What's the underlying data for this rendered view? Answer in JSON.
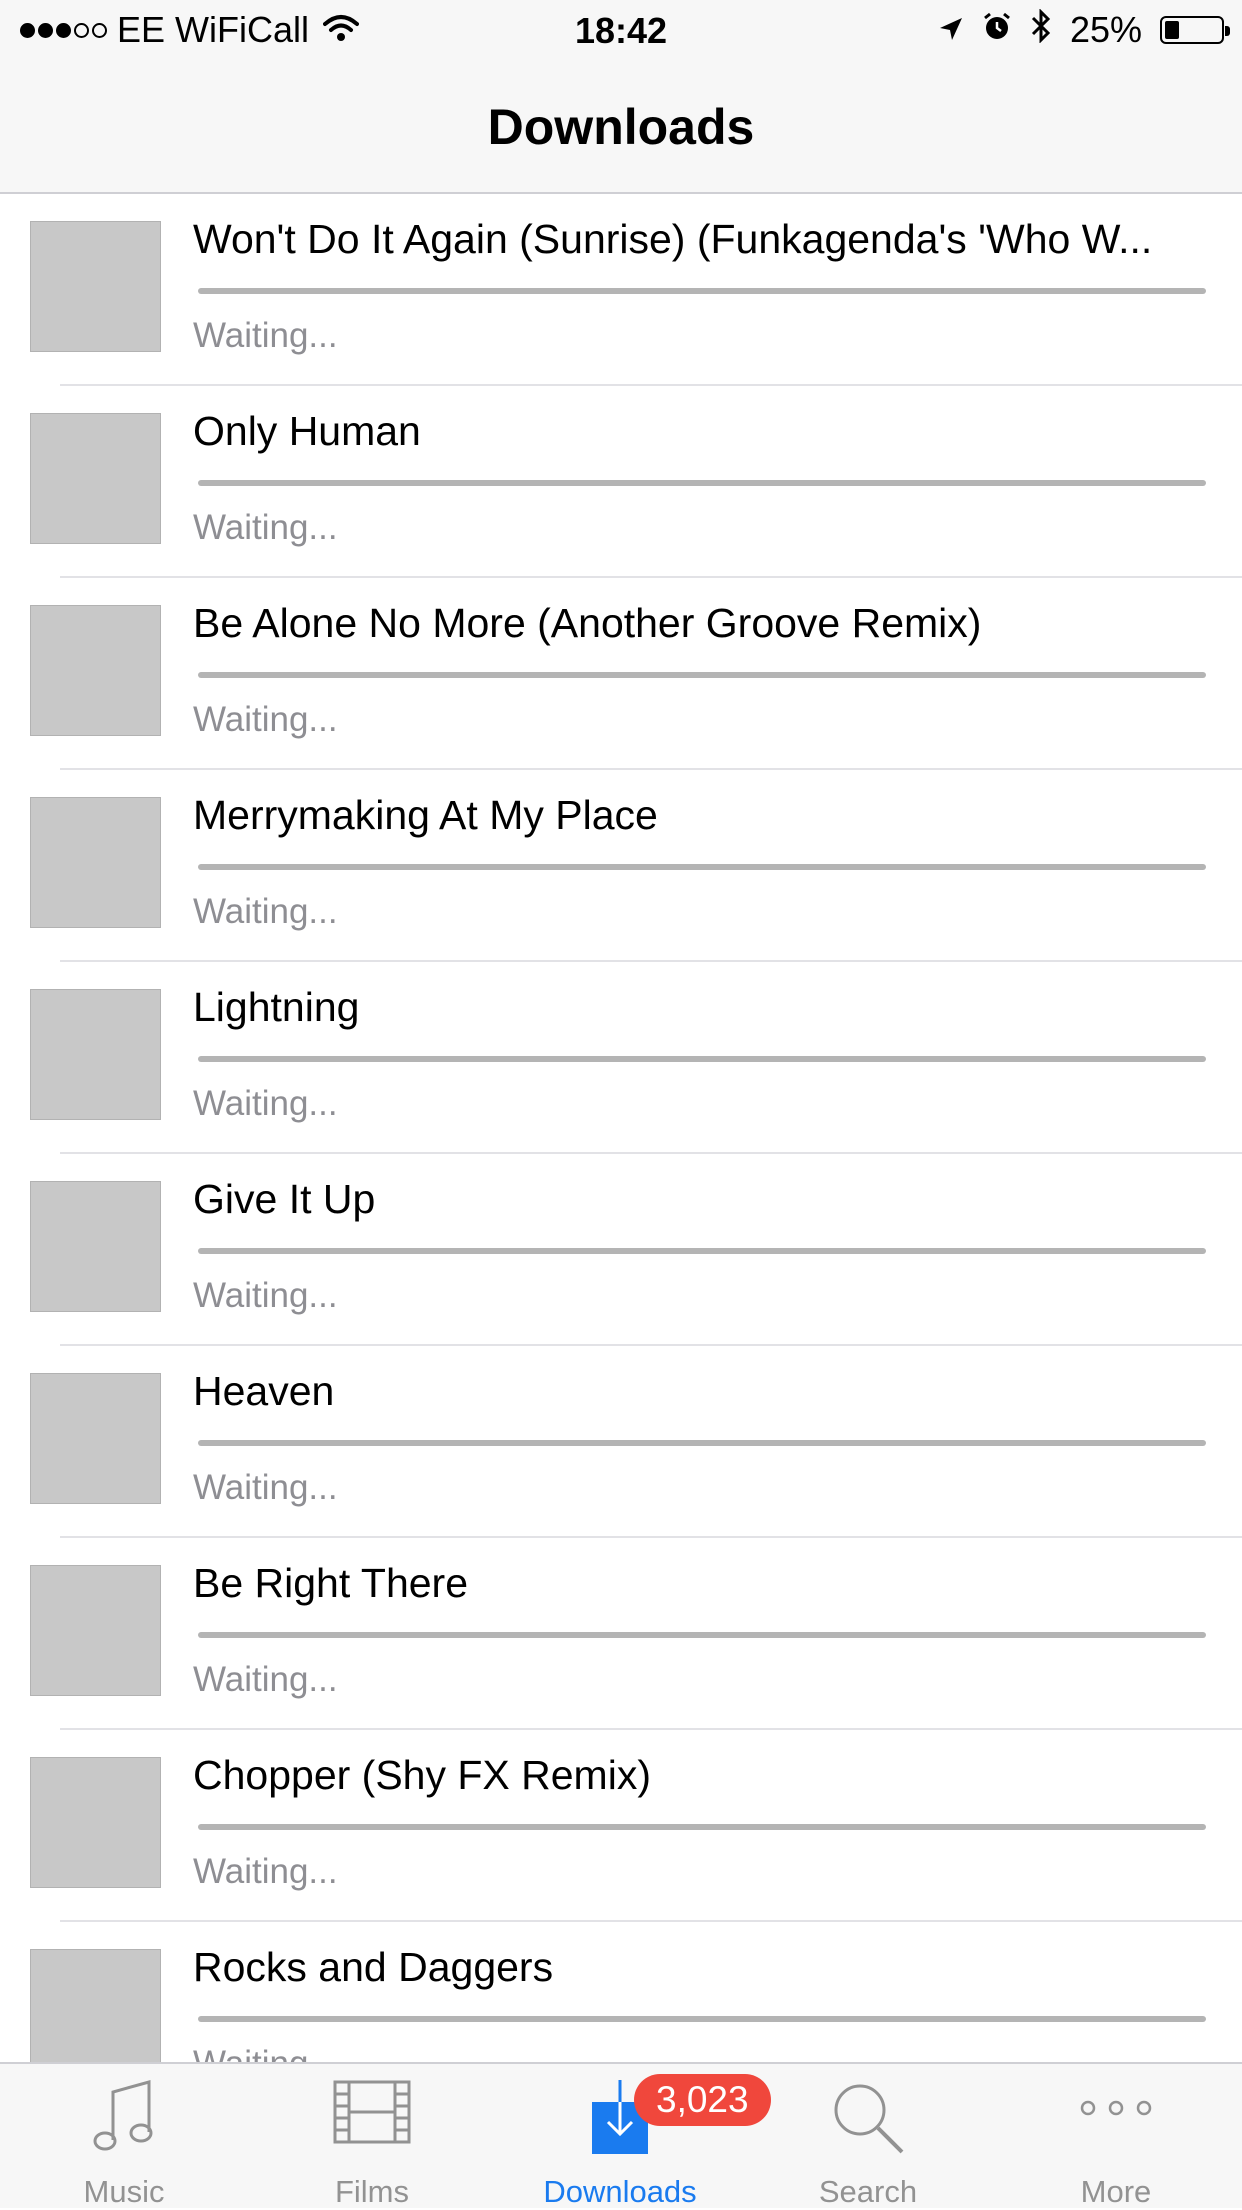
{
  "status_bar": {
    "carrier": "EE WiFiCall",
    "time": "18:42",
    "battery_percent": "25%",
    "battery_level": 0.25,
    "signal_bars_filled": 3,
    "signal_bars_total": 5
  },
  "nav": {
    "title": "Downloads"
  },
  "downloads": [
    {
      "title": "Won't Do It Again (Sunrise) (Funkagenda's 'Who W...",
      "status": "Waiting...",
      "progress": 0
    },
    {
      "title": "Only Human",
      "status": "Waiting...",
      "progress": 0
    },
    {
      "title": "Be Alone No More (Another Groove Remix)",
      "status": "Waiting...",
      "progress": 0
    },
    {
      "title": "Merrymaking At My Place",
      "status": "Waiting...",
      "progress": 0
    },
    {
      "title": "Lightning",
      "status": "Waiting...",
      "progress": 0
    },
    {
      "title": "Give It Up",
      "status": "Waiting...",
      "progress": 0
    },
    {
      "title": "Heaven",
      "status": "Waiting...",
      "progress": 0
    },
    {
      "title": "Be Right There",
      "status": "Waiting...",
      "progress": 0
    },
    {
      "title": "Chopper (Shy FX Remix)",
      "status": "Waiting...",
      "progress": 0
    },
    {
      "title": "Rocks and Daggers",
      "status": "Waiting...",
      "progress": 0
    }
  ],
  "tab_bar": {
    "active_color": "#1a7bef",
    "inactive_color": "#929292",
    "badge_color": "#f0473c",
    "badge": "3,023",
    "tabs": [
      {
        "label": "Music",
        "icon": "music-note-icon"
      },
      {
        "label": "Films",
        "icon": "film-strip-icon"
      },
      {
        "label": "Downloads",
        "icon": "download-icon",
        "active": true
      },
      {
        "label": "Search",
        "icon": "search-icon"
      },
      {
        "label": "More",
        "icon": "more-dots-icon"
      }
    ]
  }
}
